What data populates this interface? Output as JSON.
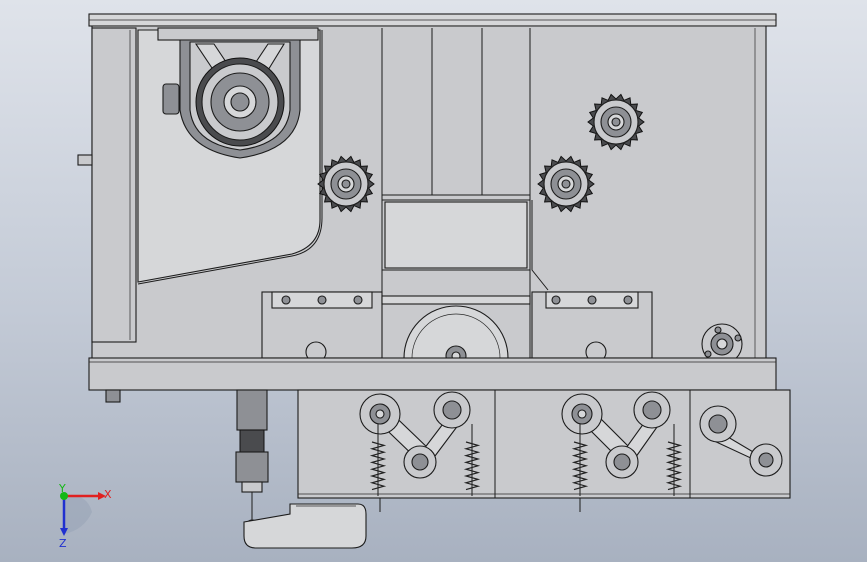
{
  "triad": {
    "x_label": "X",
    "y_label": "Y",
    "z_label": "Z",
    "x_color": "#e02020",
    "y_color": "#14b814",
    "z_color": "#2030d0"
  },
  "colors": {
    "metal": "#c9cacd",
    "dark_metal": "#8e9095",
    "background_top": "#dfe3ea",
    "background_bottom": "#a8b1c0"
  }
}
